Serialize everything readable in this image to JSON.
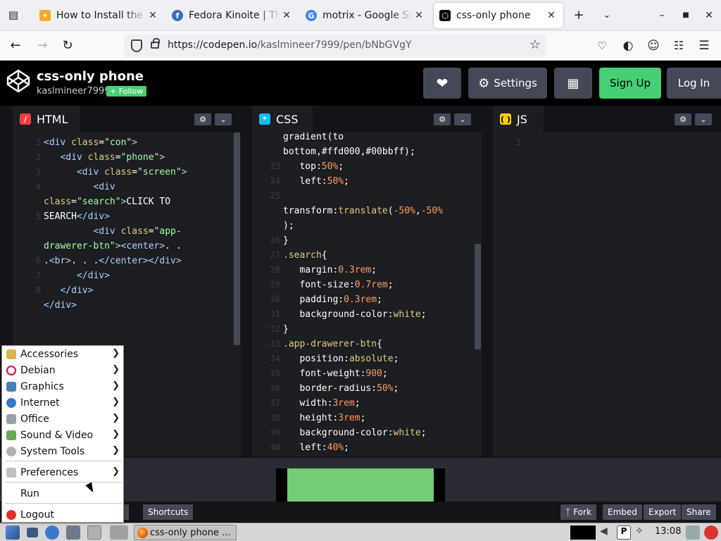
{
  "browser": {
    "tabs": [
      {
        "title": "How to Install the L",
        "favicon_color": "#f7a72a",
        "favicon_glyph": "✦",
        "active": false
      },
      {
        "title": "Fedora Kinoite | The",
        "favicon_color": "#3c6eb4",
        "favicon_glyph": "f",
        "active": false
      },
      {
        "title": "motrix - Google Sea",
        "favicon_color": "#4285f4",
        "favicon_glyph": "G",
        "active": false
      },
      {
        "title": "css-only phone",
        "favicon_color": "#000000",
        "favicon_glyph": "⬡",
        "active": true
      }
    ],
    "new_tab_icon": "plus-icon",
    "url_host": "https://codepen.io",
    "url_path": "/kaslmineer7999/pen/bNbGVgY"
  },
  "codepen": {
    "title": "css-only phone",
    "author": "kaslmineer7999",
    "follow_label": "+ Follow",
    "settings_label": "Settings",
    "signup_label": "Sign Up",
    "login_label": "Log In",
    "accent_green": "#47cf73"
  },
  "editors": {
    "html_label": "HTML",
    "css_label": "CSS",
    "js_label": "JS",
    "html_line_numbers": [
      "1",
      "2",
      "3",
      "4",
      "",
      "5",
      "",
      "",
      "6",
      "7",
      "8"
    ],
    "css_line_numbers": [
      "",
      "",
      "23",
      "24",
      "25",
      "",
      "",
      "26",
      "27",
      "28",
      "29",
      "30",
      "31",
      "32",
      "33",
      "34",
      "35",
      "36",
      "37",
      "38",
      "39",
      "40"
    ],
    "js_line_numbers": [
      "1"
    ]
  },
  "footer": {
    "shortcuts_label": "Shortcuts",
    "assets_tail": "nts",
    "fork_label": "Fork",
    "embed_label": "Embed",
    "export_label": "Export",
    "share_label": "Share"
  },
  "taskbar": {
    "task_label": "css-only phone ...",
    "clock": "13:08"
  },
  "menu": {
    "items": [
      {
        "label": "Accessories",
        "icon": "accessories-icon",
        "color": "#d9b44a",
        "submenu": true
      },
      {
        "label": "Debian",
        "icon": "debian-icon",
        "color": "#d70751",
        "submenu": true
      },
      {
        "label": "Graphics",
        "icon": "graphics-icon",
        "color": "#4a7fb5",
        "submenu": true
      },
      {
        "label": "Internet",
        "icon": "internet-icon",
        "color": "#3b79c8",
        "submenu": true
      },
      {
        "label": "Office",
        "icon": "office-icon",
        "color": "#9aa0a6",
        "submenu": true
      },
      {
        "label": "Sound & Video",
        "icon": "sound-video-icon",
        "color": "#6aa84f",
        "submenu": true
      },
      {
        "label": "System Tools",
        "icon": "system-tools-icon",
        "color": "#b0b0b0",
        "submenu": true
      },
      {
        "label": "Preferences",
        "icon": "preferences-icon",
        "color": "#c0c0c0",
        "submenu": true
      },
      {
        "label": "Run",
        "icon": "",
        "color": "",
        "submenu": false
      },
      {
        "label": "Logout",
        "icon": "logout-icon",
        "color": "#e03030",
        "submenu": false
      }
    ]
  }
}
